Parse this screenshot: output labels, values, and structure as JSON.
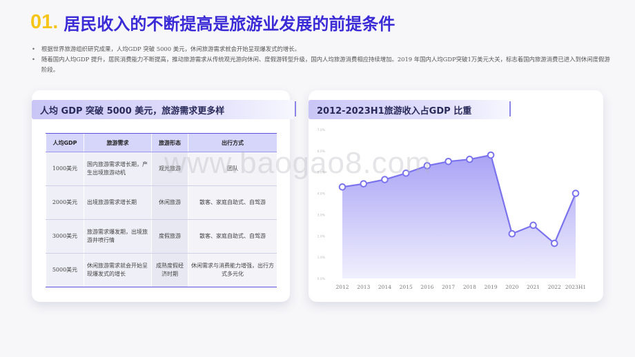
{
  "header": {
    "number": "01.",
    "title": "居民收入的不断提高是旅游业发展的前提条件"
  },
  "bullets": [
    "根据世界旅游组织研究成果，人均GDP 突破 5000 美元，休闲旅游需求就会开始呈现爆发式的增长。",
    "随着国内人均GDP 提升，居民消费能力不断提高，推动旅游需求从传统观光游向休闲、度假游转型升级，国内人均旅游消费相应持续增加。2019 年国内人均GDP突破1万美元大关，标志着国内旅游消费已进入到休闲度假游阶段。"
  ],
  "left_card": {
    "heading": "人均 GDP 突破 5000 美元，旅游需求更多样",
    "table": {
      "headers": [
        "人均GDP",
        "旅游需求",
        "旅游形态",
        "出行方式"
      ],
      "rows": [
        [
          "1000美元",
          "国内旅游需求增长期，产生出境旅游动机",
          "观光旅游",
          "团队"
        ],
        [
          "2000美元",
          "出境旅游需求增长期",
          "休闲旅游",
          "散客、家庭自助式、自驾游"
        ],
        [
          "3000美元",
          "旅游需求爆发期，出境旅游井喷行情",
          "度假旅游",
          "散客、家庭自助式、自驾游"
        ],
        [
          "5000美元",
          "休闲旅游需求就会开始呈现爆发式的增长",
          "成熟度假经济时期",
          "休闲需求与消费能力增强，出行方式多元化"
        ]
      ]
    }
  },
  "right_card": {
    "heading": "2012-2023H1旅游收入占GDP 比重"
  },
  "watermark": "www.baogao8.com",
  "chart_data": {
    "type": "area",
    "title": "2012-2023H1旅游收入占GDP 比重",
    "categories": [
      "2012",
      "2013",
      "2014",
      "2015",
      "2016",
      "2017",
      "2018",
      "2019",
      "2020",
      "2021",
      "2022",
      "2023H1"
    ],
    "values": [
      4.3,
      4.45,
      4.65,
      4.95,
      5.3,
      5.5,
      5.6,
      5.8,
      2.1,
      2.5,
      1.65,
      4.0
    ],
    "y_ticks": [
      "0.0%",
      "1.0%",
      "2.0%",
      "3.0%",
      "4.0%",
      "5.0%",
      "6.0%",
      "7.0%"
    ],
    "ylim": [
      0,
      7
    ],
    "colors": {
      "line": "#7b72ee",
      "fill_top": "#a9a3f5",
      "fill_bottom": "#f0effd",
      "marker_fill": "#ffffff"
    }
  }
}
